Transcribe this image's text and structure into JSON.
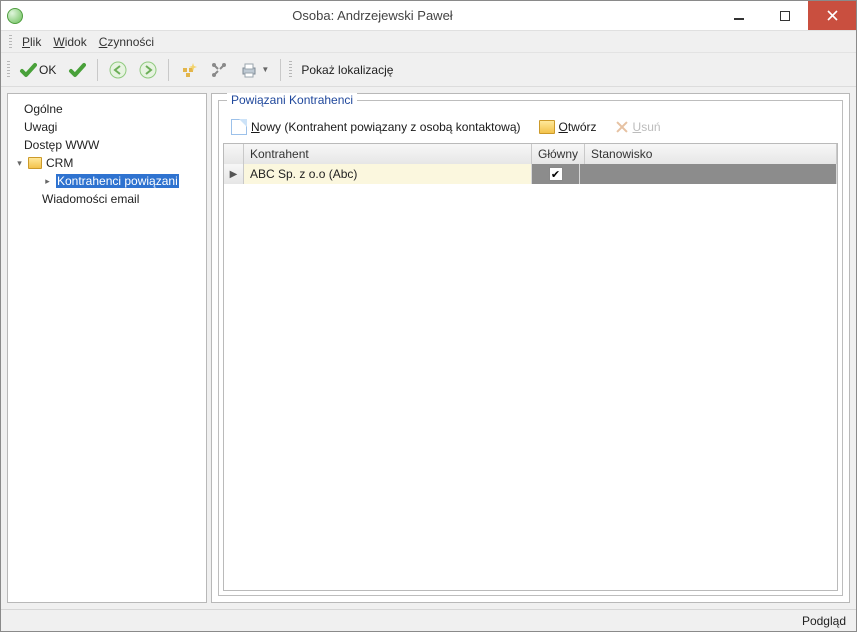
{
  "window": {
    "title": "Osoba: Andrzejewski Paweł"
  },
  "menu": {
    "file": {
      "accel": "P",
      "rest": "lik"
    },
    "view": {
      "accel": "W",
      "rest": "idok"
    },
    "actions": {
      "accel": "C",
      "rest": "zynności"
    }
  },
  "toolbar": {
    "ok": {
      "accel": "O",
      "rest": "K"
    },
    "showloc": {
      "accel": "P",
      "rest": "okaż lokalizację"
    }
  },
  "tree": {
    "general": "Ogólne",
    "notes": "Uwagi",
    "www": "Dostęp WWW",
    "crm": "CRM",
    "linked": "Kontrahenci powiązani",
    "emails": "Wiadomości email"
  },
  "panel": {
    "title": "Powiązani Kontrahenci",
    "new": {
      "accel": "N",
      "rest": "owy",
      "hint": "(Kontrahent powiązany z osobą kontaktową)"
    },
    "open": {
      "accel": "O",
      "rest": "twórz"
    },
    "del": {
      "accel": "U",
      "rest": "suń"
    }
  },
  "grid": {
    "cols": {
      "contractor": "Kontrahent",
      "main": "Główny",
      "position": "Stanowisko"
    },
    "rows": [
      {
        "contractor": "ABC Sp. z o.o (Abc)",
        "main": true,
        "position": ""
      }
    ]
  },
  "status": {
    "preview": "Podgląd"
  }
}
